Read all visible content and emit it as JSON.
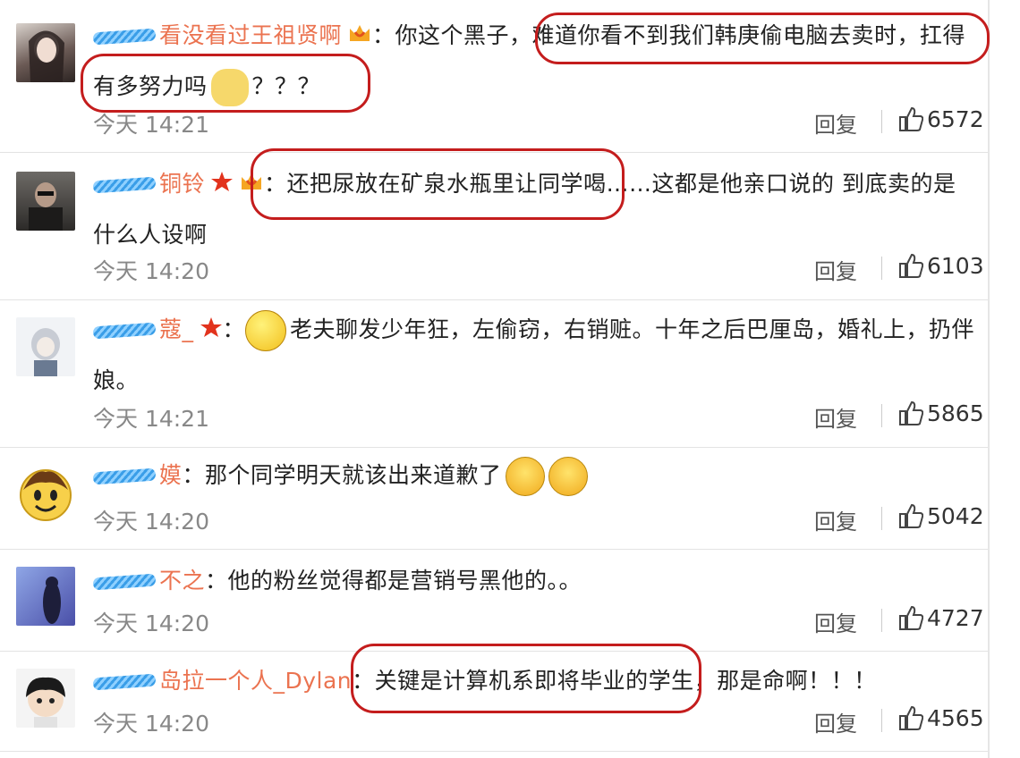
{
  "comments": [
    {
      "user": "看没看过王祖贤啊",
      "text": "：你这个黑子，难道你看不到我们韩庚偷电脑去卖时，扛得有多努力吗",
      "suffix": "？？？",
      "time": "今天 14:21",
      "reply": "回复",
      "likes": "6572"
    },
    {
      "user": "铜铃",
      "text": "：还把尿放在矿泉水瓶里让同学喝……这都是他亲口说的 到底卖的是什么人设啊",
      "time": "今天 14:20",
      "reply": "回复",
      "likes": "6103"
    },
    {
      "user": "蔻_",
      "text": "老夫聊发少年狂，左偷窃，右销赃。十年之后巴厘岛，婚礼上，扔伴娘。",
      "time": "今天 14:21",
      "reply": "回复",
      "likes": "5865"
    },
    {
      "user": "嫫",
      "text": "：那个同学明天就该出来道歉了",
      "time": "今天 14:20",
      "reply": "回复",
      "likes": "5042"
    },
    {
      "user": "不之",
      "text": "：他的粉丝觉得都是营销号黑他的。。",
      "time": "今天 14:20",
      "reply": "回复",
      "likes": "4727"
    },
    {
      "user": "岛拉一个人_Dylan",
      "text": "：关键是计算机系即将毕业的学生，那是命啊！！！",
      "time": "今天 14:20",
      "reply": "回复",
      "likes": "4565"
    }
  ],
  "colors": {
    "username": "#eb7350",
    "highlight": "#c41d1d",
    "time": "#888888"
  },
  "icons": {
    "like": "thumbs-up-icon",
    "star": "star-icon",
    "crown": "crown-icon"
  }
}
